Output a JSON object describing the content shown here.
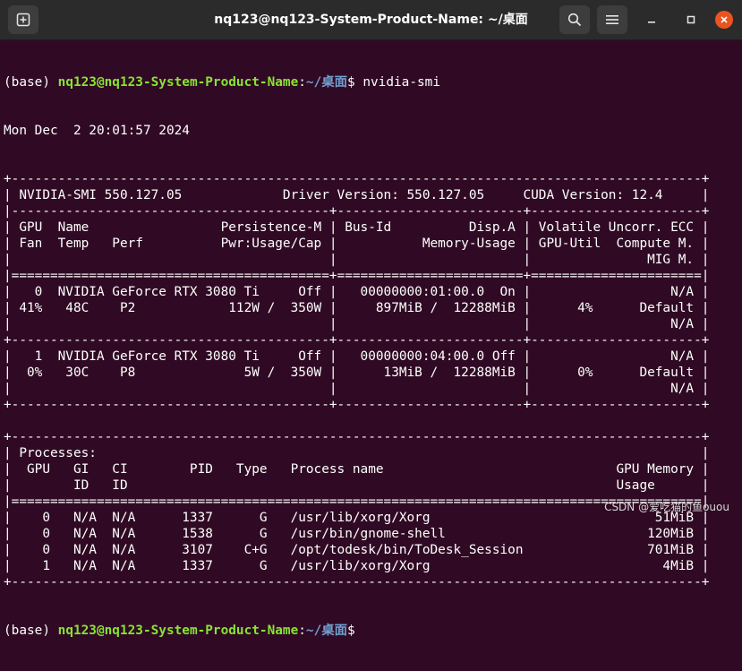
{
  "window": {
    "title": "nq123@nq123-System-Product-Name: ~/桌面",
    "buttons": {
      "new_tab_icon": "new-tab-icon",
      "search_icon": "search-icon",
      "menu_icon": "hamburger-menu-icon",
      "minimize_icon": "minimize-icon",
      "maximize_icon": "maximize-icon",
      "close_icon": "close-icon"
    },
    "colors": {
      "background": "#300a24",
      "titlebar": "#2b2b2b",
      "prompt_user": "#8ae234",
      "prompt_path": "#729fcf",
      "close": "#e95420"
    }
  },
  "terminal": {
    "prompt1": {
      "env": "(base) ",
      "user": "nq123@nq123-System-Product-Name",
      "sep": ":",
      "path": "~/桌面",
      "sign": "$ ",
      "command": "nvidia-smi"
    },
    "date_line": "Mon Dec  2 20:01:57 2024",
    "lines": [
      "+-----------------------------------------------------------------------------------------+",
      "| NVIDIA-SMI 550.127.05             Driver Version: 550.127.05     CUDA Version: 12.4     |",
      "|-----------------------------------------+------------------------+----------------------+",
      "| GPU  Name                 Persistence-M | Bus-Id          Disp.A | Volatile Uncorr. ECC |",
      "| Fan  Temp   Perf          Pwr:Usage/Cap |           Memory-Usage | GPU-Util  Compute M. |",
      "|                                         |                        |               MIG M. |",
      "|=========================================+========================+======================|",
      "|   0  NVIDIA GeForce RTX 3080 Ti     Off |   00000000:01:00.0  On |                  N/A |",
      "| 41%   48C    P2            112W /  350W |     897MiB /  12288MiB |      4%      Default |",
      "|                                         |                        |                  N/A |",
      "+-----------------------------------------+------------------------+----------------------+",
      "|   1  NVIDIA GeForce RTX 3080 Ti     Off |   00000000:04:00.0 Off |                  N/A |",
      "|  0%   30C    P8              5W /  350W |      13MiB /  12288MiB |      0%      Default |",
      "|                                         |                        |                  N/A |",
      "+-----------------------------------------+------------------------+----------------------+",
      "",
      "+-----------------------------------------------------------------------------------------+",
      "| Processes:                                                                              |",
      "|  GPU   GI   CI        PID   Type   Process name                              GPU Memory |",
      "|        ID   ID                                                               Usage      |",
      "|=========================================================================================|",
      "|    0   N/A  N/A      1337      G   /usr/lib/xorg/Xorg                             51MiB |",
      "|    0   N/A  N/A      1538      G   /usr/bin/gnome-shell                          120MiB |",
      "|    0   N/A  N/A      3107    C+G   /opt/todesk/bin/ToDesk_Session                701MiB |",
      "|    1   N/A  N/A      1337      G   /usr/lib/xorg/Xorg                              4MiB |",
      "+-----------------------------------------------------------------------------------------+"
    ],
    "prompt2": {
      "env": "(base) ",
      "user": "nq123@nq123-System-Product-Name",
      "sep": ":",
      "path": "~/桌面",
      "sign": "$"
    }
  },
  "watermark": "CSDN @爱吃猫的鱼ouou"
}
